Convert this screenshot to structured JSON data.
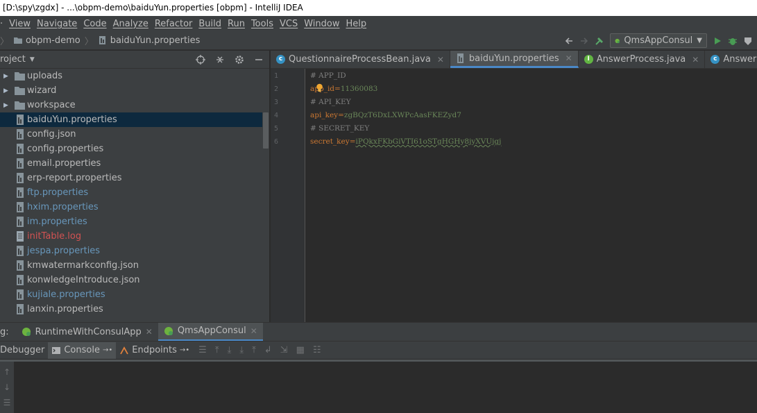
{
  "window": {
    "title": "[D:\\spy\\zgdx] - ...\\obpm-demo\\baiduYun.properties [obpm] - IntelliJ IDEA"
  },
  "menu": [
    "View",
    "Navigate",
    "Code",
    "Analyze",
    "Refactor",
    "Build",
    "Run",
    "Tools",
    "VCS",
    "Window",
    "Help"
  ],
  "breadcrumb": {
    "project": "obpm-demo",
    "file": "baiduYun.properties"
  },
  "run_config": {
    "name": "QmsAppConsul"
  },
  "project_panel": {
    "title": "roject"
  },
  "tree": [
    {
      "label": "uploads",
      "type": "folder",
      "color": "#bbbbbb"
    },
    {
      "label": "wizard",
      "type": "folder",
      "color": "#bbbbbb"
    },
    {
      "label": "workspace",
      "type": "folder",
      "color": "#bbbbbb"
    },
    {
      "label": "baiduYun.properties",
      "type": "props",
      "color": "#bbbbbb",
      "selected": true
    },
    {
      "label": "config.json",
      "type": "json",
      "color": "#bbbbbb"
    },
    {
      "label": "config.properties",
      "type": "props",
      "color": "#bbbbbb"
    },
    {
      "label": "email.properties",
      "type": "props",
      "color": "#bbbbbb"
    },
    {
      "label": "erp-report.properties",
      "type": "props",
      "color": "#bbbbbb"
    },
    {
      "label": "ftp.properties",
      "type": "props",
      "color": "#6897bb"
    },
    {
      "label": "hxim.properties",
      "type": "props",
      "color": "#6897bb"
    },
    {
      "label": "im.properties",
      "type": "props",
      "color": "#6897bb"
    },
    {
      "label": "initTable.log",
      "type": "log",
      "color": "#d25252"
    },
    {
      "label": "jespa.properties",
      "type": "props",
      "color": "#6897bb"
    },
    {
      "label": "kmwatermarkconfig.json",
      "type": "json",
      "color": "#bbbbbb"
    },
    {
      "label": "konwledgeIntroduce.json",
      "type": "json",
      "color": "#bbbbbb"
    },
    {
      "label": "kujiale.properties",
      "type": "props",
      "color": "#6897bb"
    },
    {
      "label": "lanxin.properties",
      "type": "props",
      "color": "#bbbbbb"
    }
  ],
  "editor_tabs": [
    {
      "label": "QuestionnaireProcessBean.java",
      "icon": "class"
    },
    {
      "label": "baiduYun.properties",
      "icon": "props",
      "active": true
    },
    {
      "label": "AnswerProcess.java",
      "icon": "interface"
    },
    {
      "label": "AnswerProcessBean",
      "icon": "class"
    }
  ],
  "code": [
    {
      "n": "1",
      "comment": "# APP_ID"
    },
    {
      "n": "2",
      "key": "app_id",
      "value": "11360083"
    },
    {
      "n": "3",
      "comment": "# API_KEY"
    },
    {
      "n": "4",
      "key": "api_key",
      "value": "zgBQzT6DxLXWPcAasFKEZyd7"
    },
    {
      "n": "5",
      "comment": "# SECRET_KEY"
    },
    {
      "n": "6",
      "key": "secret_key",
      "value": "iPQkxFKbGiVTI61oSTgHGHy8jyXVUjgj"
    }
  ],
  "bottom": {
    "run_label": "g:",
    "run_tabs": [
      {
        "label": "RuntimeWithConsulApp"
      },
      {
        "label": "QmsAppConsul",
        "active": true
      }
    ],
    "subtabs": [
      {
        "label": "Debugger"
      },
      {
        "label": "Console",
        "active": true
      },
      {
        "label": "Endpoints"
      }
    ]
  }
}
